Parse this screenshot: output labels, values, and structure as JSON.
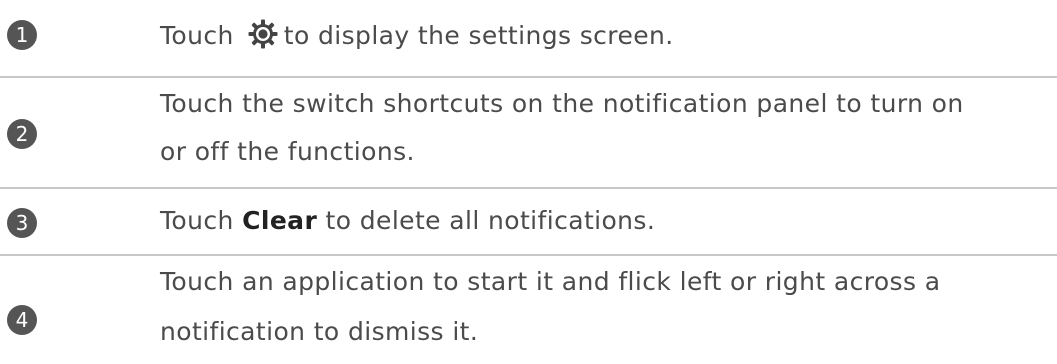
{
  "steps": [
    {
      "number": "1",
      "before_icon": "Touch",
      "icon": "gear-icon",
      "after_icon": "to display the settings screen."
    },
    {
      "number": "2",
      "line1": "Touch the switch shortcuts on the notification panel to turn on",
      "line2": "or off the functions."
    },
    {
      "number": "3",
      "before_bold": "Touch ",
      "bold": "Clear",
      "after_bold": " to delete all notifications."
    },
    {
      "number": "4",
      "line1": "Touch an application to start it and flick left or right across a",
      "line2": "notification to dismiss it."
    }
  ],
  "colors": {
    "badge": "#555555",
    "text": "#4b4b4b",
    "divider": "#c8c8c8"
  }
}
